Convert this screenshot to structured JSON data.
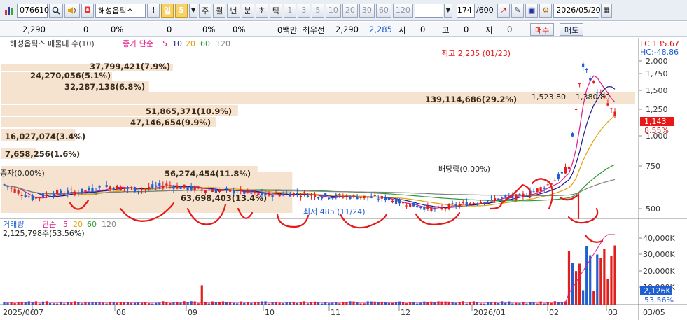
{
  "toolbar": {
    "code": "076610",
    "stock_name": "해성옵틱스",
    "period_active": "일",
    "period_value": "5",
    "periods": [
      "주",
      "월",
      "년",
      "분",
      "초",
      "틱"
    ],
    "intervals": [
      "1",
      "3",
      "5",
      "10",
      "20",
      "30",
      "60",
      "120"
    ],
    "count": "174",
    "count_total": "/600",
    "date": "2026/05/20"
  },
  "quote": {
    "price": "2,290",
    "v1": "0",
    "p1": "0%",
    "v2": "0",
    "p2": "0%",
    "p3": "0%",
    "unit_label": "0백만",
    "best_label": "최우선",
    "best_ask": "2,290",
    "best_bid": "2,285",
    "open_label": "시",
    "open_val": "0",
    "high_label": "고",
    "high_val": "0",
    "low_label": "저",
    "low_val": "0",
    "buy_label": "매수",
    "sell_label": "매도"
  },
  "price_panel": {
    "legend_name": "해성옵틱스 매물대 수(10)",
    "legend_ma_label": "종가 단순",
    "legend_ma": [
      "5",
      "10",
      "20",
      "60",
      "120"
    ],
    "legend_ma_colors": [
      "#e0188a",
      "#1a1a8c",
      "#e0a000",
      "#2a9a3a",
      "#808080"
    ],
    "lc_label": "LC:135.67",
    "hc_label": "HC:-48.86",
    "current_price": "1,143",
    "current_change": "8.55%",
    "high_annotation": "최고 2,235 (01/23)",
    "low_annotation": "최저 485 (11/24)",
    "dividend_annotation": "배당락(0.00%)",
    "rights_annotation": "증자(0.00%)",
    "y_ticks": [
      "2,000",
      "1,750",
      "1,500",
      "1,250",
      "1,000",
      "750",
      "500"
    ]
  },
  "volume_profile": [
    {
      "label": "7,658,256(1.6%)",
      "pct": 1.6
    },
    {
      "label": "16,027,074(3.4%)",
      "pct": 3.4
    },
    {
      "label": "47,146,654(9.9%)",
      "pct": 9.9
    },
    {
      "label": "51,865,371(10.9%)",
      "pct": 10.9
    },
    {
      "label": "139,114,686(29.2%)",
      "pct": 29.2
    },
    {
      "label": "32,287,138(6.8%)",
      "pct": 6.8
    },
    {
      "label": "24,270,056(5.1%)",
      "pct": 5.1
    },
    {
      "label": "37,799,421(7.9%)",
      "pct": 7.9
    },
    {
      "label": "56,274,454(11.8%)",
      "pct": 11.8
    },
    {
      "label": "63,698,403(13.4%)",
      "pct": 13.4
    }
  ],
  "overlay_labels": [
    "1,523.80",
    "1,380.80"
  ],
  "volume_panel": {
    "legend_name": "거래량",
    "legend_ma_label": "단순",
    "legend_ma": [
      "5",
      "20",
      "60",
      "120"
    ],
    "current_volume": "2,125,798주(53.56%)",
    "current_tag": "2,126K",
    "current_pct": "53.56%",
    "y_ticks": [
      "40,000K",
      "30,000K",
      "20,000K",
      "10,000K"
    ]
  },
  "x_axis": [
    "2025/06",
    "07",
    "08",
    "09",
    "10",
    "11",
    "12",
    "2026/01",
    "02",
    "03",
    "03/05"
  ],
  "colors": {
    "up": "#e0201c",
    "down": "#1f5fd0",
    "profile": "#f5e3cf",
    "annotation_red": "#e81818",
    "tag_red": "#e81818"
  }
}
